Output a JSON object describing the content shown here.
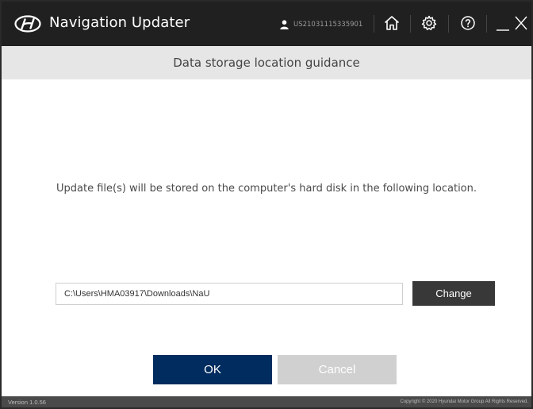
{
  "window": {
    "app_title": "Navigation Updater",
    "user_id": "US21031115335901"
  },
  "titlebar_icons": {
    "user": "user-icon",
    "home": "home-icon",
    "settings": "gear-icon",
    "help": "help-icon",
    "minimize": "minimize-icon",
    "close": "close-icon"
  },
  "header": {
    "title": "Data storage location guidance"
  },
  "main": {
    "message": "Update file(s) will be stored on the computer's hard disk in the following location.",
    "path_value": "C:\\Users\\HMA03917\\Downloads\\NaU",
    "change_label": "Change",
    "ok_label": "OK",
    "cancel_label": "Cancel"
  },
  "footer": {
    "version": "Version 1.0.56",
    "copyright": "Copyright © 2020 Hyundai Motor Group All Rights Reserved."
  },
  "colors": {
    "titlebar": "#202020",
    "header_band": "#e6e6e6",
    "ok_button": "#002c5f",
    "change_button": "#383838",
    "cancel_button": "#d0d0d0",
    "footer": "#4a4a4a"
  }
}
